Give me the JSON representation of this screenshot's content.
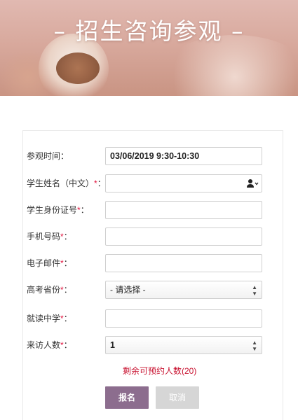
{
  "banner": {
    "title": "– 招生咨询参观 –"
  },
  "form": {
    "visit_time": {
      "label": "参观时间：",
      "value": "03/06/2019 9:30-10:30"
    },
    "student_name": {
      "label": "学生姓名（中文）",
      "required": "*",
      "suffix": "：",
      "value": ""
    },
    "id_number": {
      "label": "学生身份证号",
      "required": "*",
      "suffix": "：",
      "value": ""
    },
    "phone": {
      "label": "手机号码",
      "required": "*",
      "suffix": "：",
      "value": ""
    },
    "email": {
      "label": "电子邮件",
      "required": "*",
      "suffix": "：",
      "value": ""
    },
    "province": {
      "label": "高考省份",
      "required": "*",
      "suffix": "：",
      "value": "- 请选择 -"
    },
    "school": {
      "label": "就读中学",
      "required": "*",
      "suffix": "：",
      "value": ""
    },
    "visitors": {
      "label": "来访人数",
      "required": "*",
      "suffix": "：",
      "value": "1"
    }
  },
  "remaining_text": "剩余可预约人数(20)",
  "buttons": {
    "submit": "报名",
    "cancel": "取消"
  },
  "icons": {
    "person": "person-icon",
    "dropdown": "chevron-down-icon",
    "select_arrows": "updown-arrows-icon"
  },
  "colors": {
    "required": "#e1123c",
    "remaining": "#c8102e",
    "submit_bg": "#8c6d8e",
    "cancel_bg": "#d6d6d6"
  }
}
